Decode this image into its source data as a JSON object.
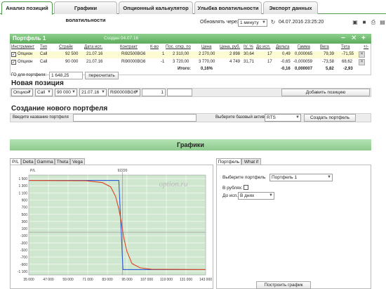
{
  "tabs": [
    "Анализ позиций",
    "Графики волатильности",
    "Опционный калькулятор",
    "Улыбка волатильности",
    "Экспорт данных"
  ],
  "refresh": {
    "label": "Обновлять через",
    "interval": "1 минуту",
    "timestamp": "04.07.2016 23:25:20"
  },
  "portfolio": {
    "title": "Портфель 1",
    "created": "Создан 04.07.16",
    "columns": [
      "Инструмент",
      "Тип",
      "Страйк",
      "Дата исп.",
      "Контракт",
      "К-во",
      "Пос. откр. по",
      "Цена",
      "Цена, руб.",
      "IV, %",
      "До исп.",
      "Дельта",
      "Гамма",
      "Вега",
      "Тета",
      "+/-"
    ],
    "rows": [
      [
        "Опцион",
        "Call",
        "92 500",
        "21.07.16",
        "Ri92500BG6",
        "1",
        "2 310,00",
        "2 270,00",
        "2 898",
        "30,64",
        "17",
        "0,49",
        "0,000065",
        "79,39",
        "-71,55"
      ],
      [
        "Опцион",
        "Call",
        "90 000",
        "21.07.16",
        "Ri90000BG6",
        "-1",
        "3 720,00",
        "3 770,00",
        "4 749",
        "31,71",
        "17",
        "-0,65",
        "-0,000059",
        "-73,58",
        "68,62"
      ]
    ],
    "total": {
      "label": "Итого:",
      "pct": "0,16%",
      "delta": "-0,16",
      "gamma": "0,000007",
      "vega": "5,82",
      "theta": "-2,93"
    },
    "go_label": "ГО для портфеля:",
    "go_value": "1 648,25",
    "recalc": "пересчитать"
  },
  "new_position": {
    "title": "Новая позиция",
    "instrument": "Опцион",
    "type": "Call",
    "strike": "90 000",
    "date": "21.07.16",
    "contract": "Ri90000BG6",
    "qty": "1",
    "add": "Добавить позицию"
  },
  "create": {
    "title": "Создание нового портфеля",
    "name_label": "Введите название портфеля",
    "asset_label": "Выберите базовый актив",
    "asset": "RTS",
    "button": "Создать портфель"
  },
  "charts": {
    "header": "Графики",
    "subtabs": [
      "P/L",
      "Delta",
      "Gamma",
      "Theta",
      "Vega"
    ],
    "right_tabs": [
      "Портфель",
      "What if"
    ],
    "watermark": "option.ru",
    "select_portfolio_label": "Выберите портфель",
    "portfolio": "Портфель 1",
    "rub_label": "В рублях:",
    "until_label": "До исп.:",
    "until": "В днях",
    "build": "Построить график",
    "colors": {
      "blue": "#2f5bd8",
      "red": "#e0451f",
      "area": "#cfe6cf"
    }
  },
  "chart_data": {
    "type": "line",
    "ylabel": "P/L",
    "top_label": "92220",
    "x_ticks": [
      "35 000",
      "47 000",
      "59 000",
      "71 000",
      "83 000",
      "95 000",
      "107 000",
      "119 000",
      "131 000",
      "143 000"
    ],
    "y_ticks": [
      "1 500",
      "1 300",
      "1 100",
      "900",
      "700",
      "500",
      "300",
      "100",
      "-100",
      "-300",
      "-500",
      "-700",
      "-900",
      "-1 100"
    ],
    "xlim": [
      35000,
      143000
    ],
    "ylim": [
      -1200,
      1600
    ],
    "series": [
      {
        "color": "blue",
        "x": [
          35000,
          90000,
          92500,
          143000
        ],
        "y": [
          1450,
          1450,
          -1050,
          -1050
        ]
      },
      {
        "color": "red",
        "x": [
          35000,
          70000,
          80000,
          85000,
          88000,
          90000,
          91500,
          93000,
          95000,
          98000,
          103000,
          110000,
          143000
        ],
        "y": [
          1450,
          1440,
          1390,
          1270,
          1000,
          650,
          300,
          -150,
          -550,
          -880,
          -1000,
          -1040,
          -1050
        ]
      }
    ]
  }
}
